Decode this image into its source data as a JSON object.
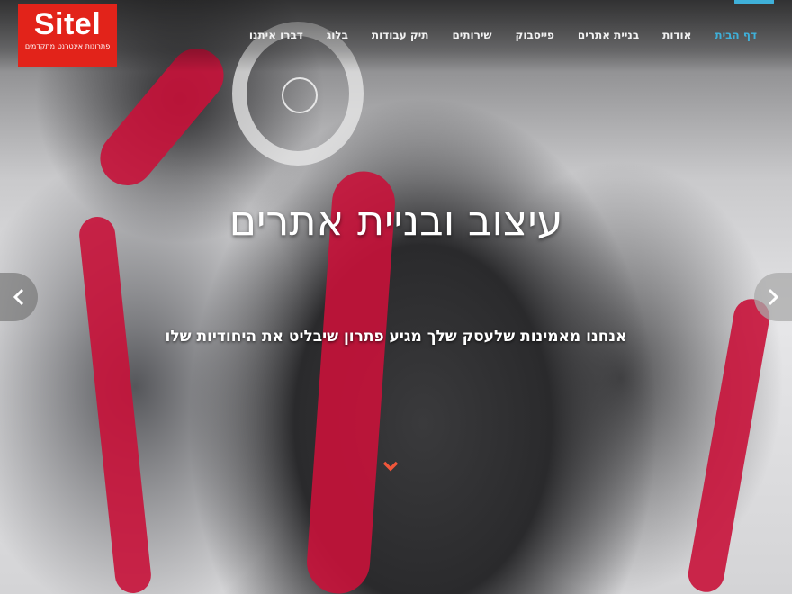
{
  "logo": {
    "name": "Sitel",
    "tagline": "פתרונות אינטרנט מתקדמים"
  },
  "nav": {
    "items": [
      {
        "label": "דף הבית",
        "active": true
      },
      {
        "label": "אודות"
      },
      {
        "label": "בניית אתרים"
      },
      {
        "label": "פייסבוק"
      },
      {
        "label": "שירותים"
      },
      {
        "label": "תיק עבודות"
      },
      {
        "label": "בלוג"
      },
      {
        "label": "דברו איתנו"
      }
    ]
  },
  "hero": {
    "headline": "עיצוב ובניית אתרים",
    "subline": "אנחנו מאמינות שלעסק שלך מגיע פתרון שיבליט את היחודיות שלו",
    "prev_icon": "chevron-left-icon",
    "next_icon": "chevron-right-icon",
    "scroll_icon": "chevron-down-icon"
  },
  "colors": {
    "brand_red": "#e2231a",
    "accent_blue": "#3fb0d9",
    "scroll_arrow": "#f0563a"
  }
}
